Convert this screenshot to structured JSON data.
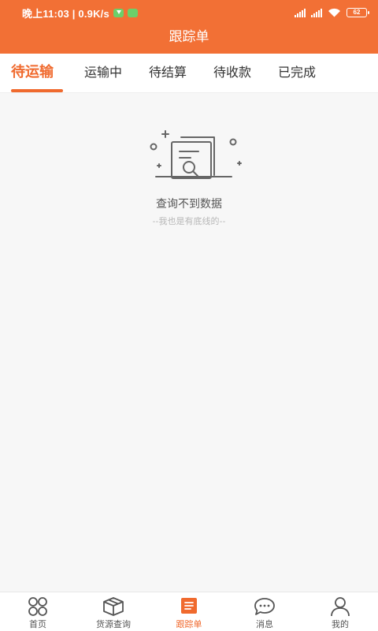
{
  "status_bar": {
    "time": "晚上11:03 | 0.9K/s",
    "battery": "62"
  },
  "header": {
    "title": "跟踪单"
  },
  "tabs": [
    {
      "label": "待运输",
      "active": true
    },
    {
      "label": "运输中",
      "active": false
    },
    {
      "label": "待结算",
      "active": false
    },
    {
      "label": "待收款",
      "active": false
    },
    {
      "label": "已完成",
      "active": false
    }
  ],
  "empty_state": {
    "icon": "document-search-icon",
    "title": "查询不到数据",
    "subtitle": "--我也是有底线的--"
  },
  "bottom_nav": [
    {
      "label": "首页",
      "icon": "home-grid-icon",
      "active": false
    },
    {
      "label": "货源查询",
      "icon": "package-icon",
      "active": false
    },
    {
      "label": "跟踪单",
      "icon": "tracking-list-icon",
      "active": true
    },
    {
      "label": "消息",
      "icon": "chat-bubble-icon",
      "active": false
    },
    {
      "label": "我的",
      "icon": "user-icon",
      "active": false
    }
  ],
  "colors": {
    "brand": "#f27035",
    "accent": "#f06a2e",
    "background": "#f7f7f7"
  }
}
